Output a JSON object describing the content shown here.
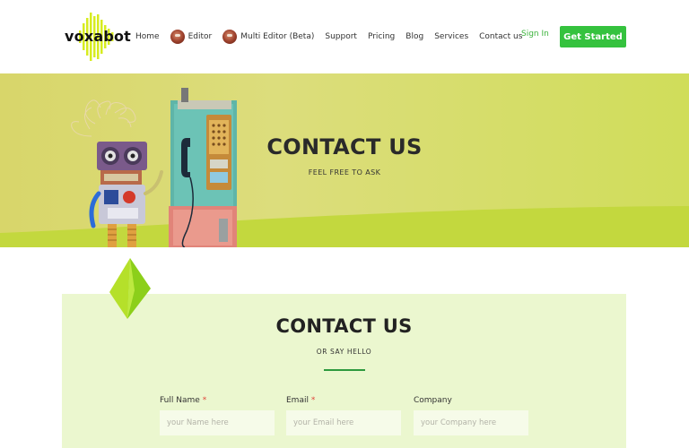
{
  "header": {
    "logo_text": "voxabot",
    "nav": [
      {
        "label": "Home",
        "avatar": false
      },
      {
        "label": "Editor",
        "avatar": true
      },
      {
        "label": "Multi Editor (Beta)",
        "avatar": true
      },
      {
        "label": "Support",
        "avatar": false
      },
      {
        "label": "Pricing",
        "avatar": false
      },
      {
        "label": "Blog",
        "avatar": false
      },
      {
        "label": "Services",
        "avatar": false
      },
      {
        "label": "Contact us",
        "avatar": false
      }
    ],
    "sign_in": "Sign In",
    "get_started": "Get Started"
  },
  "hero": {
    "title": "CONTACT US",
    "subtitle": "FEEL FREE TO ASK"
  },
  "contact": {
    "title": "CONTACT US",
    "subtitle": "OR SAY HELLO",
    "fields": [
      {
        "label": "Full Name",
        "required": true,
        "placeholder": "your Name here"
      },
      {
        "label": "Email",
        "required": true,
        "placeholder": "your Email here"
      },
      {
        "label": "Company",
        "required": false,
        "placeholder": "your Company here"
      }
    ],
    "required_mark": "*"
  },
  "colors": {
    "accent_green": "#35c23e",
    "sign_in_green": "#3cb33c",
    "card_bg": "#ebf7cf",
    "hero_bg": "#dcdd7c",
    "required_red": "#e0453a"
  }
}
